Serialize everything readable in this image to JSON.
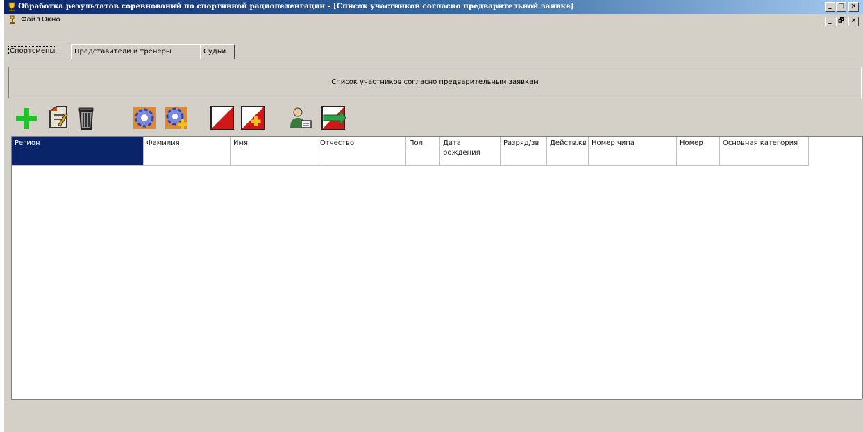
{
  "window": {
    "title": "Обработка результатов соревнований по спортивной радиопеленгации - [Список участников согласно предварительной заявке]",
    "title_controls": [
      "_",
      "□",
      "×"
    ],
    "mdi_controls": [
      "_",
      "🗗",
      "×"
    ]
  },
  "menu": {
    "items": [
      "Файл",
      "Окно"
    ]
  },
  "tabs": [
    {
      "label": "Спортсмены",
      "active": true
    },
    {
      "label": "Представители и тренеры",
      "active": false
    },
    {
      "label": "Судьи",
      "active": false
    }
  ],
  "header": {
    "caption": "Список участников согласно предварительным заявкам"
  },
  "toolbar": {
    "buttons": [
      {
        "name": "add-icon",
        "color": "#22c02a"
      },
      {
        "name": "edit-icon",
        "color": "#c8451f"
      },
      {
        "name": "delete-icon",
        "color": "#404040"
      },
      {
        "name": "settings-gear-icon",
        "color": "#6a7fd8"
      },
      {
        "name": "settings-gear-add-icon",
        "color": "#6a7fd8"
      },
      {
        "name": "flag-control-icon",
        "color": "#d01818"
      },
      {
        "name": "flag-control-add-icon",
        "color": "#d01818"
      },
      {
        "name": "person-card-icon",
        "color": "#3a7a3a"
      },
      {
        "name": "export-flag-icon",
        "color": "#2fa04a"
      }
    ]
  },
  "grid": {
    "columns": [
      "Регион",
      "Фамилия",
      "Имя",
      "Отчество",
      "Пол",
      "Дата рождения",
      "Разряд/зв",
      "Действ.кв",
      "Номер чипа",
      "Номер",
      "Основная категория"
    ],
    "selected_column": "Регион",
    "rows": []
  },
  "colors": {
    "titlebar_start": "#0a246a",
    "titlebar_end": "#a6caf0",
    "window_bg": "#d4d0c8",
    "selection": "#0a246a"
  }
}
